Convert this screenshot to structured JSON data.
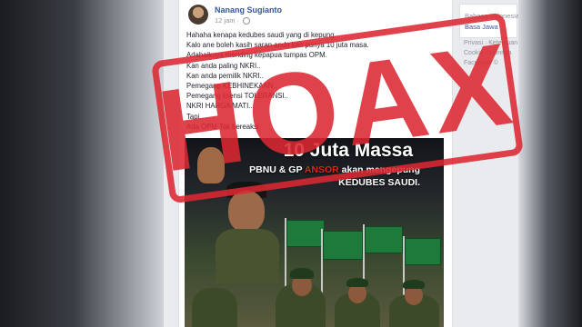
{
  "post": {
    "author": "Nanang Sugianto",
    "time": "12 jam ·",
    "lines": [
      "Hahaha kenapa kedubes saudi yang di kepung.",
      "Kalo ane boleh kasih saran anda kan punya 10 juta masa.",
      "Adabaiknya mending kepapua tumpas OPM.",
      "Kan anda paling NKRI..",
      "Kan anda pemilik NKRI..",
      "Pemegang KEBHINEKAAN..",
      "Pemegang lisensi TOLERANSI..",
      "NKRI HARGA MATI..",
      "Tapi..",
      "Ada OPM Tak bereaksi"
    ]
  },
  "image": {
    "title": "10 Juta Massa",
    "subtitle_a": "PBNU & GP ",
    "subtitle_red": "ANSOR",
    "subtitle_b": " akan mengepung",
    "subtitle2": "KEDUBES SAUDI."
  },
  "stamp": {
    "text": "HOAX",
    "color": "#dc2832"
  },
  "sidebar": {
    "lang_current": "Bahasa Indonesia",
    "lang_alt": "Basa Jawa",
    "links": [
      "Privasi · Ketentuan",
      "Cookie · Lainnya",
      "Facebook ©"
    ]
  },
  "colors": {
    "link": "#365899",
    "muted": "#90949c",
    "page_bg": "#e9ebee"
  }
}
